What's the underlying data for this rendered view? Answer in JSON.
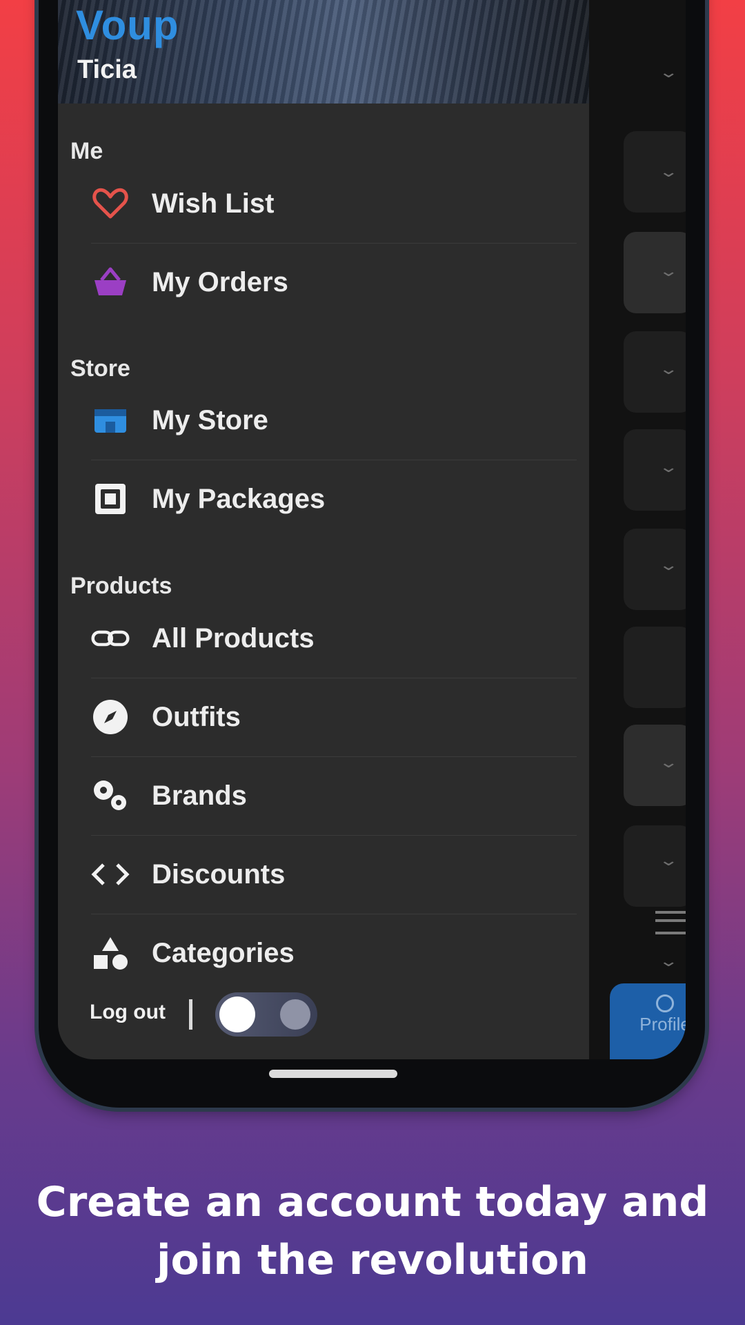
{
  "header": {
    "brand": "Voup",
    "user_name": "Ticia"
  },
  "sections": {
    "me": {
      "title": "Me",
      "items": [
        {
          "label": "Wish List",
          "icon": "heart-icon"
        },
        {
          "label": "My Orders",
          "icon": "basket-icon"
        }
      ]
    },
    "store": {
      "title": "Store",
      "items": [
        {
          "label": "My Store",
          "icon": "store-icon"
        },
        {
          "label": "My Packages",
          "icon": "package-icon"
        }
      ]
    },
    "products": {
      "title": "Products",
      "items": [
        {
          "label": "All Products",
          "icon": "link-icon"
        },
        {
          "label": "Outfits",
          "icon": "compass-icon"
        },
        {
          "label": "Brands",
          "icon": "gears-icon"
        },
        {
          "label": "Discounts",
          "icon": "code-brackets-icon"
        },
        {
          "label": "Categories",
          "icon": "shapes-icon"
        }
      ]
    }
  },
  "footer": {
    "logout_label": "Log out",
    "dark_mode": true
  },
  "bottom_tab": {
    "label": "Profile"
  },
  "caption": {
    "line1": "Create an account today and",
    "line2": "join the revolution"
  },
  "colors": {
    "background_top": "#f23f45",
    "background_bottom": "#4c3a92",
    "drawer": "#2c2c2c",
    "brand": "#2f8ee0",
    "heart": "#e5534b",
    "orders": "#9b3fc4",
    "store": "#2f8ee0"
  }
}
